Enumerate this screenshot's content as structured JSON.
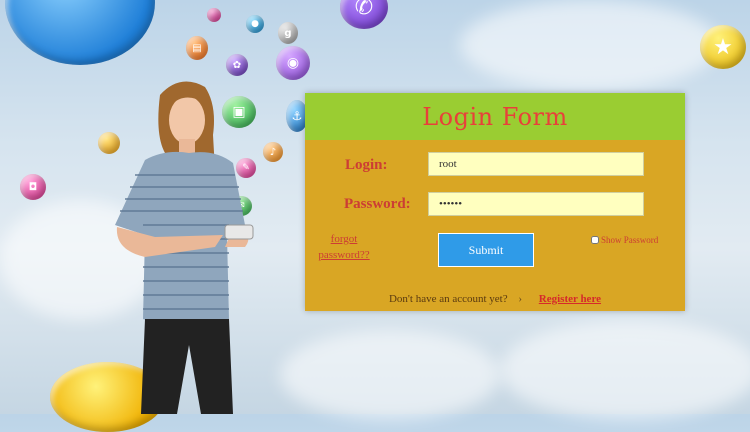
{
  "login": {
    "title": "Login Form",
    "login_label": "Login:",
    "login_value": "root",
    "password_label": "Password:",
    "password_value": "••••••",
    "forgot_line1": "forgot",
    "forgot_line2": "password??",
    "submit_label": "Submit",
    "show_password_label": "Show Password",
    "no_account_text": "Don't have an account yet?",
    "separator": "›",
    "register_label": "Register here"
  },
  "colors": {
    "header_bg": "#9acd32",
    "card_bg": "#d9a624",
    "title": "#e8403a",
    "input_bg": "#ffffbf",
    "submit_bg": "#2f9be8"
  },
  "decor": {
    "bubble_icons": [
      "phone-icon",
      "star-icon",
      "camera-icon",
      "chat-icon",
      "music-icon",
      "book-icon",
      "app-icon"
    ]
  }
}
